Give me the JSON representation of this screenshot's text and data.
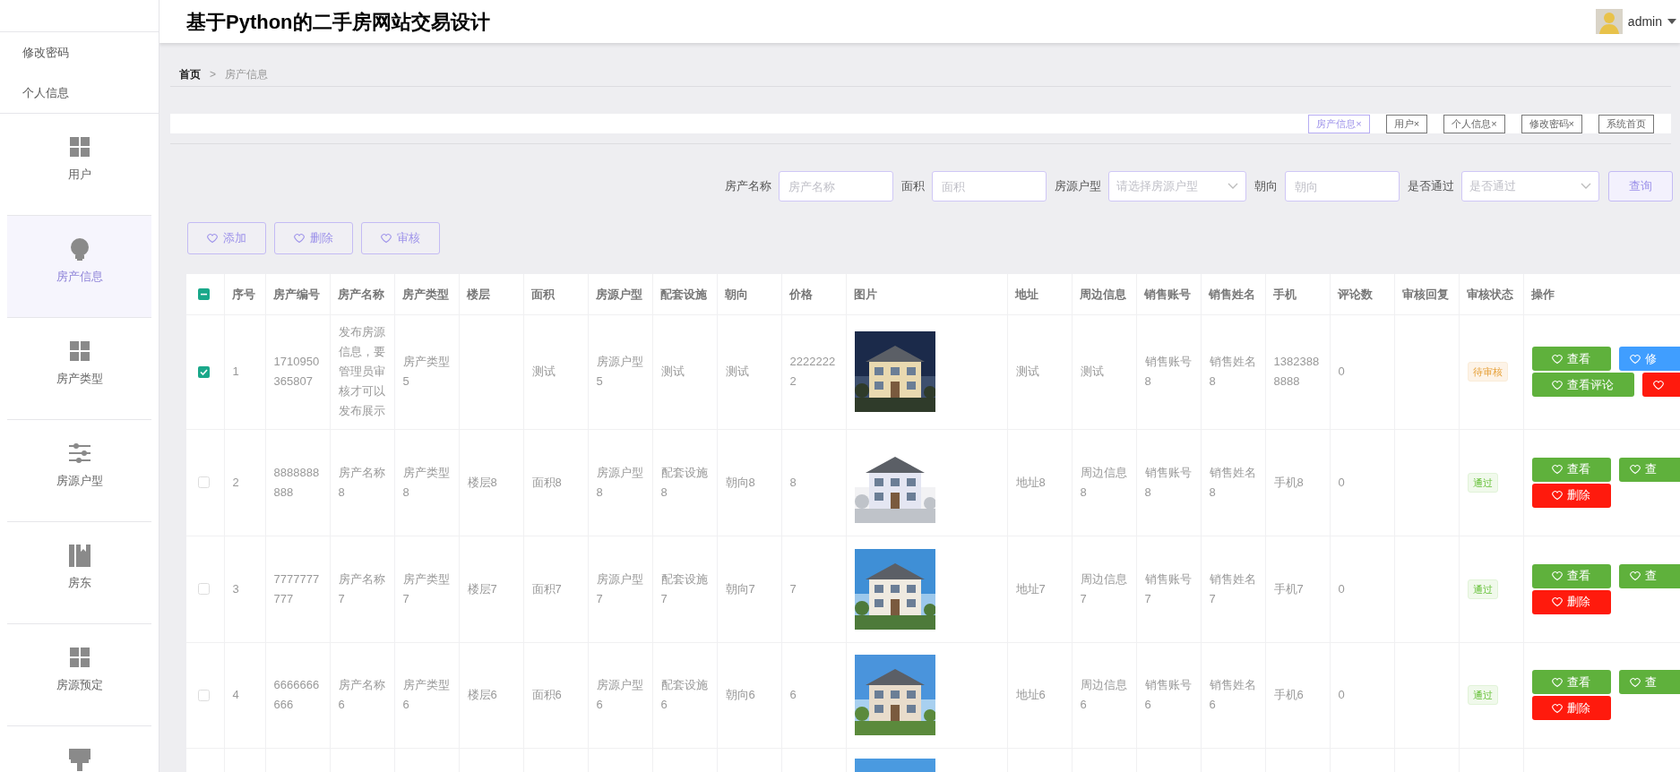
{
  "sidebar": {
    "menu_items": [
      {
        "label": "修改密码"
      },
      {
        "label": "个人信息"
      }
    ],
    "nav_items": [
      {
        "label": "用户",
        "kind": "grid",
        "selected": false
      },
      {
        "label": "房产信息",
        "kind": "bulb",
        "selected": true
      },
      {
        "label": "房产类型",
        "kind": "grid",
        "selected": false
      },
      {
        "label": "房源户型",
        "kind": "sliders",
        "selected": false
      },
      {
        "label": "房东",
        "kind": "book",
        "selected": false
      },
      {
        "label": "房源预定",
        "kind": "grid",
        "selected": false
      },
      {
        "kind": "brush"
      }
    ]
  },
  "header": {
    "title": "基于Python的二手房网站交易设计",
    "user": "admin"
  },
  "breadcrumb": {
    "separator": ">",
    "items": [
      {
        "label": "首页",
        "current": false
      },
      {
        "label": "房产信息",
        "current": true
      }
    ]
  },
  "tags": [
    {
      "label": "房产信息",
      "close": "×",
      "selected": true
    },
    {
      "label": "用户",
      "close": "×",
      "selected": false
    },
    {
      "label": "个人信息",
      "close": "×",
      "selected": false
    },
    {
      "label": "修改密码",
      "close": "×",
      "selected": false
    },
    {
      "label": "系统首页",
      "selected": false
    }
  ],
  "search": {
    "fields": [
      {
        "label": "房产名称",
        "kind": "input",
        "placeholder": "房产名称"
      },
      {
        "label": "面积",
        "kind": "input",
        "placeholder": "面积"
      },
      {
        "label": "房源户型",
        "kind": "select",
        "placeholder": "请选择房源户型"
      },
      {
        "label": "朝向",
        "kind": "input",
        "placeholder": "朝向"
      },
      {
        "label": "是否通过",
        "kind": "select",
        "placeholder": "是否通过"
      }
    ],
    "button": "查询"
  },
  "toolbar": [
    "添加",
    "删除",
    "审核"
  ],
  "table": {
    "header_checkbox": {
      "checked": true,
      "indeterminate": true
    },
    "columns": [
      "序号",
      "房产编号",
      "房产名称",
      "房产类型",
      "楼层",
      "面积",
      "房源户型",
      "配套设施",
      "朝向",
      "价格",
      "图片",
      "地址",
      "周边信息",
      "销售账号",
      "销售姓名",
      "手机",
      "评论数",
      "审核回复",
      "审核状态",
      "操作"
    ],
    "rows": [
      {
        "selected": true,
        "no": "1",
        "code": "1710950365807",
        "name": "发布房源信息，要管理员审核才可以发布展示",
        "type": "房产类型5",
        "area": "测试",
        "layout": "房源户型5",
        "facilities": "测试",
        "orientation": "测试",
        "price": "22222222",
        "address": "测试",
        "nearby": "测试",
        "sales_account": "销售账号8",
        "sales_name": "销售姓名8",
        "phone": "13823888888",
        "comments": "0",
        "status": {
          "label": "待审核",
          "kind": "pending"
        },
        "actions": [
          [
            {
              "kind": "success",
              "label": "查看"
            },
            {
              "kind": "primary",
              "label": "修"
            }
          ],
          [
            {
              "kind": "success",
              "label": "查看评论"
            },
            {
              "kind": "danger"
            }
          ]
        ]
      },
      {
        "selected": false,
        "no": "2",
        "code": "8888888888",
        "name": "房产名称8",
        "type": "房产类型8",
        "floor": "楼层8",
        "area": "面积8",
        "layout": "房源户型8",
        "facilities": "配套设施8",
        "orientation": "朝向8",
        "price": "8",
        "address": "地址8",
        "nearby": "周边信息8",
        "sales_account": "销售账号8",
        "sales_name": "销售姓名8",
        "phone": "手机8",
        "comments": "0",
        "status": {
          "label": "通过",
          "kind": "passed"
        },
        "actions": [
          [
            {
              "kind": "success",
              "label": "查看"
            },
            {
              "kind": "success",
              "label": "查"
            }
          ],
          [
            {
              "kind": "danger",
              "label": "删除"
            }
          ]
        ]
      },
      {
        "selected": false,
        "no": "3",
        "code": "7777777777",
        "name": "房产名称7",
        "type": "房产类型7",
        "floor": "楼层7",
        "area": "面积7",
        "layout": "房源户型7",
        "facilities": "配套设施7",
        "orientation": "朝向7",
        "price": "7",
        "address": "地址7",
        "nearby": "周边信息7",
        "sales_account": "销售账号7",
        "sales_name": "销售姓名7",
        "phone": "手机7",
        "comments": "0",
        "status": {
          "label": "通过",
          "kind": "passed"
        },
        "actions": [
          [
            {
              "kind": "success",
              "label": "查看"
            },
            {
              "kind": "success",
              "label": "查"
            }
          ],
          [
            {
              "kind": "danger",
              "label": "删除"
            }
          ]
        ]
      },
      {
        "selected": false,
        "no": "4",
        "code": "6666666666",
        "name": "房产名称6",
        "type": "房产类型6",
        "floor": "楼层6",
        "area": "面积6",
        "layout": "房源户型6",
        "facilities": "配套设施6",
        "orientation": "朝向6",
        "price": "6",
        "address": "地址6",
        "nearby": "周边信息6",
        "sales_account": "销售账号6",
        "sales_name": "销售姓名6",
        "phone": "手机6",
        "comments": "0",
        "status": {
          "label": "通过",
          "kind": "passed"
        },
        "actions": [
          [
            {
              "kind": "success",
              "label": "查看"
            },
            {
              "kind": "success",
              "label": "查"
            }
          ],
          [
            {
              "kind": "danger",
              "label": "删除"
            }
          ]
        ]
      }
    ]
  }
}
